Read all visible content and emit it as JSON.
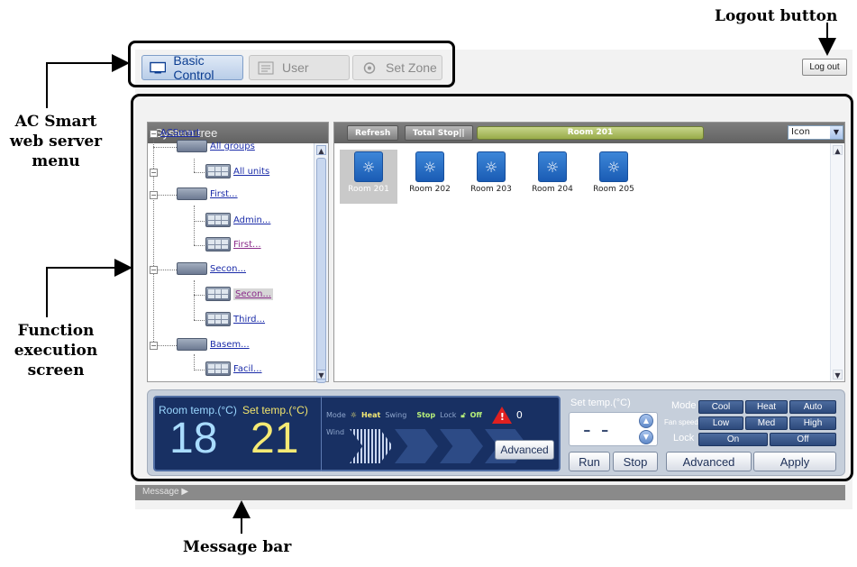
{
  "annotations": {
    "logout": "Logout button",
    "menu": [
      "AC Smart",
      "web server",
      "menu"
    ],
    "function": [
      "Function",
      "execution",
      "screen"
    ],
    "message": "Message bar"
  },
  "tabs": {
    "basic": "Basic Control",
    "user": "User",
    "set_zone": "Set Zone"
  },
  "logout_label": "Log out",
  "tree": {
    "header": "System tree",
    "root": "ACSmart",
    "nodes": {
      "all_groups": "All groups",
      "all_units": "All units",
      "first_group": "First...",
      "admin": "Admin...",
      "first_unit": "First...",
      "second_group": "Secon...",
      "second_unit": "Secon...",
      "third": "Third...",
      "basement": "Basem...",
      "facil": "Facil..."
    }
  },
  "toolbar": {
    "refresh": "Refresh",
    "total_stop": "Total Stop||",
    "current_room": "Room 201",
    "view": "Icon"
  },
  "rooms": [
    "Room 201",
    "Room 202",
    "Room 203",
    "Room 204",
    "Room 205"
  ],
  "status": {
    "room_temp_label": "Room temp.(°C)",
    "set_temp_label": "Set temp.(°C)",
    "room_temp": "18",
    "set_temp": "21",
    "mode_label": "Mode",
    "mode_value": "Heat",
    "swing_label": "Swing",
    "swing_value": "Stop",
    "lock_label": "Lock",
    "lock_value": "Off",
    "alarm_count": "0",
    "wind_label": "Wind",
    "advanced": "Advanced"
  },
  "set_temp_panel": {
    "label": "Set temp.(°C)",
    "value": "- -",
    "run": "Run",
    "stop": "Stop"
  },
  "options": {
    "mode_label": "Mode",
    "fan_label": "Fan speed",
    "lock_label": "Lock",
    "mode": [
      "Cool",
      "Heat",
      "Auto"
    ],
    "fan": [
      "Low",
      "Med",
      "High"
    ],
    "lock": [
      "On",
      "Off"
    ],
    "advanced": "Advanced",
    "apply": "Apply"
  },
  "message_bar": "Message ▶",
  "colors": {
    "status_bg": "#183063",
    "room_temp": "#a9dcff",
    "set_temp": "#f6ea74",
    "room_banner": "#a8b85a",
    "option_button": "#3a5a8e"
  }
}
